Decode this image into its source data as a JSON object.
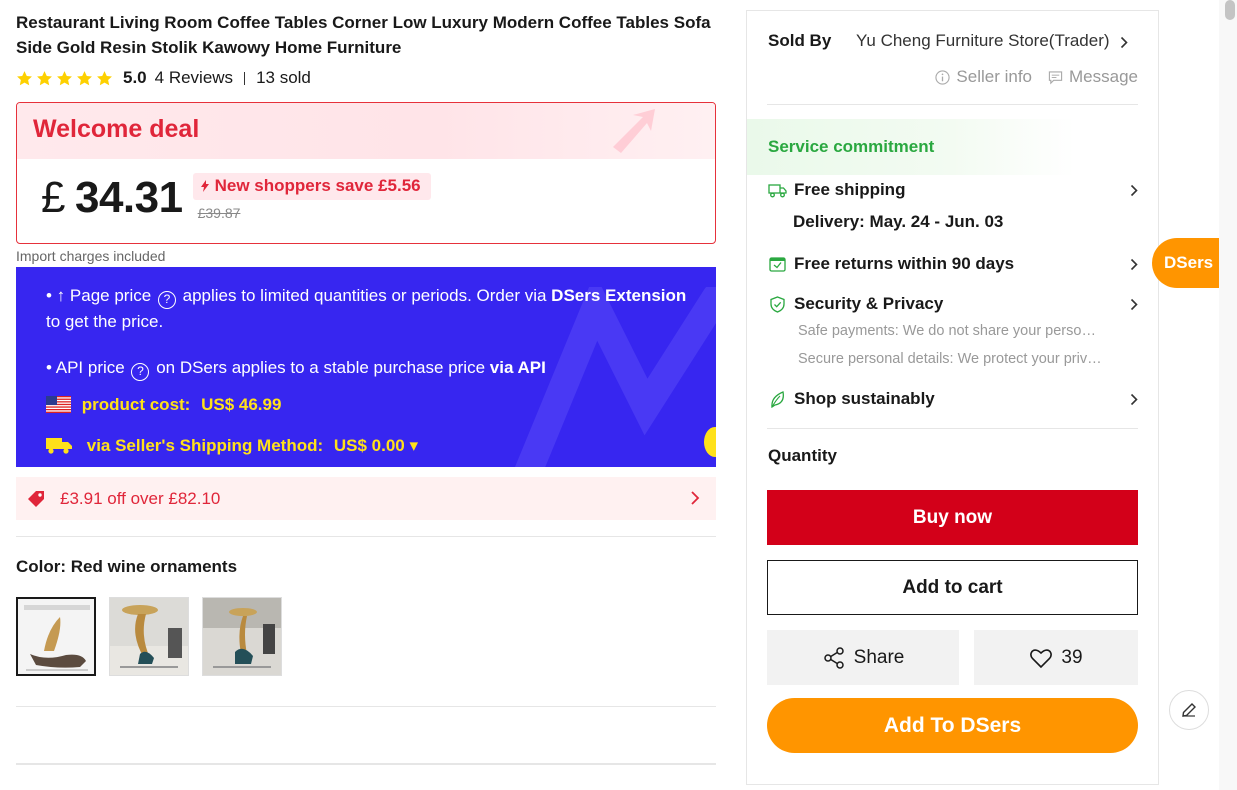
{
  "product": {
    "title": "Restaurant Living Room Coffee Tables Corner Low Luxury Modern Coffee Tables Sofa Side Gold Resin Stolik Kawowy Home Furniture",
    "rating": "5.0",
    "reviews": "4 Reviews",
    "sold": "13 sold",
    "stars": 5
  },
  "deal": {
    "label": "Welcome deal",
    "currency": "£",
    "price": "34.31",
    "save_text": "New shoppers save",
    "save_amount": "£5.56",
    "old_price": "£39.87",
    "import_note": "Import charges included"
  },
  "dsers_panel": {
    "line1_a": "• ↑ Page price",
    "line1_b": "applies to limited quantities or periods. Order via",
    "line1_bold": "DSers Extension",
    "line1_c": "to get the price.",
    "line2_a": "• API price",
    "line2_b": "on DSers applies to a stable purchase price",
    "line2_bold": "via API",
    "product_cost_label": "product cost:",
    "product_cost_value": "US$ 46.99",
    "shipping_label": "via Seller's Shipping Method:",
    "shipping_value": "US$ 0.00",
    "q": "?"
  },
  "coupon": {
    "text": "£3.91 off over £82.10"
  },
  "color": {
    "label": "Color:",
    "value": "Red wine ornaments"
  },
  "seller": {
    "sold_by_label": "Sold By",
    "store": "Yu Cheng Furniture Store(Trader)",
    "info": "Seller info",
    "message": "Message"
  },
  "service": {
    "title": "Service commitment",
    "shipping": "Free shipping",
    "delivery": "Delivery: May. 24 - Jun. 03",
    "returns": "Free returns within 90 days",
    "security": "Security & Privacy",
    "security_sub1": "Safe payments: We do not share your personal details with any third parties",
    "security_sub2": "Secure personal details: We protect your privacy and keep your details safe",
    "sustainable": "Shop sustainably"
  },
  "purchase": {
    "quantity_label": "Quantity",
    "buy_now": "Buy now",
    "add_to_cart": "Add to cart",
    "share": "Share",
    "wishlist_count": "39",
    "add_to_dsers": "Add To DSers"
  },
  "dsers_tab": "DSers",
  "colors": {
    "accent_red": "#d30019",
    "deal_red": "#e0263a",
    "dsers_purple": "#3726f0",
    "dsers_orange": "#ff9500",
    "service_green": "#2aa840",
    "highlight_yellow": "#ffe11a"
  }
}
